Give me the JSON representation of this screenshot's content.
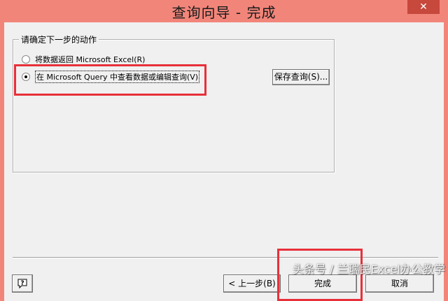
{
  "window": {
    "title": "查询向导 - 完成",
    "close_label": "✕"
  },
  "group": {
    "legend": "请确定下一步的动作",
    "options": [
      {
        "label": "将数据返回 Microsoft Excel(R)",
        "selected": false
      },
      {
        "label": "在 Microsoft Query 中查看数据或编辑查询(V)",
        "selected": true
      }
    ],
    "save_button": "保存查询(S)..."
  },
  "footer": {
    "back_button": "< 上一步(B)",
    "finish_button": "完成",
    "cancel_button": "取消"
  },
  "watermark": "头条号 / 兰瑞民Excel办公教学",
  "colors": {
    "title_bar": "#f2857a",
    "highlight_box": "#e8303a",
    "dialog_bg": "#f0f0f0"
  },
  "icons": {
    "help": "help-question-icon"
  }
}
